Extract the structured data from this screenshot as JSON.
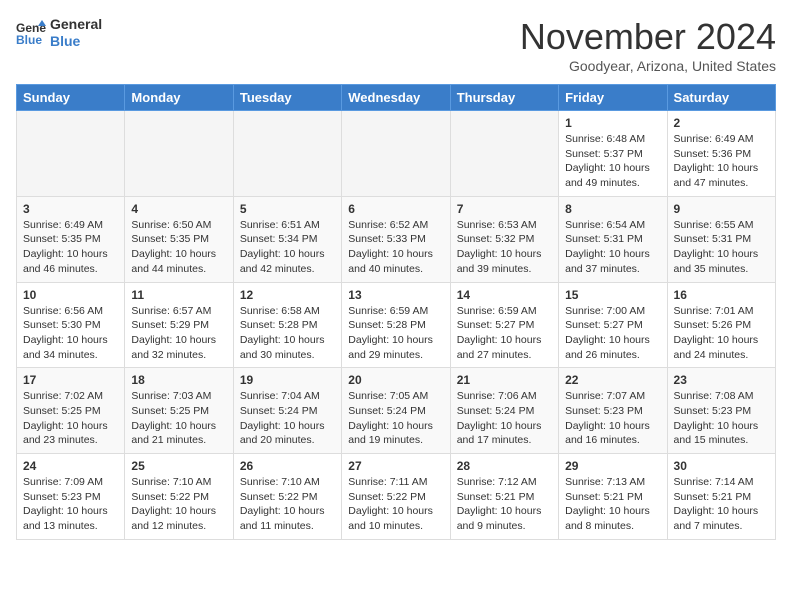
{
  "header": {
    "logo_line1": "General",
    "logo_line2": "Blue",
    "month": "November 2024",
    "location": "Goodyear, Arizona, United States"
  },
  "weekdays": [
    "Sunday",
    "Monday",
    "Tuesday",
    "Wednesday",
    "Thursday",
    "Friday",
    "Saturday"
  ],
  "weeks": [
    [
      {
        "num": "",
        "info": ""
      },
      {
        "num": "",
        "info": ""
      },
      {
        "num": "",
        "info": ""
      },
      {
        "num": "",
        "info": ""
      },
      {
        "num": "",
        "info": ""
      },
      {
        "num": "1",
        "info": "Sunrise: 6:48 AM\nSunset: 5:37 PM\nDaylight: 10 hours\nand 49 minutes."
      },
      {
        "num": "2",
        "info": "Sunrise: 6:49 AM\nSunset: 5:36 PM\nDaylight: 10 hours\nand 47 minutes."
      }
    ],
    [
      {
        "num": "3",
        "info": "Sunrise: 6:49 AM\nSunset: 5:35 PM\nDaylight: 10 hours\nand 46 minutes."
      },
      {
        "num": "4",
        "info": "Sunrise: 6:50 AM\nSunset: 5:35 PM\nDaylight: 10 hours\nand 44 minutes."
      },
      {
        "num": "5",
        "info": "Sunrise: 6:51 AM\nSunset: 5:34 PM\nDaylight: 10 hours\nand 42 minutes."
      },
      {
        "num": "6",
        "info": "Sunrise: 6:52 AM\nSunset: 5:33 PM\nDaylight: 10 hours\nand 40 minutes."
      },
      {
        "num": "7",
        "info": "Sunrise: 6:53 AM\nSunset: 5:32 PM\nDaylight: 10 hours\nand 39 minutes."
      },
      {
        "num": "8",
        "info": "Sunrise: 6:54 AM\nSunset: 5:31 PM\nDaylight: 10 hours\nand 37 minutes."
      },
      {
        "num": "9",
        "info": "Sunrise: 6:55 AM\nSunset: 5:31 PM\nDaylight: 10 hours\nand 35 minutes."
      }
    ],
    [
      {
        "num": "10",
        "info": "Sunrise: 6:56 AM\nSunset: 5:30 PM\nDaylight: 10 hours\nand 34 minutes."
      },
      {
        "num": "11",
        "info": "Sunrise: 6:57 AM\nSunset: 5:29 PM\nDaylight: 10 hours\nand 32 minutes."
      },
      {
        "num": "12",
        "info": "Sunrise: 6:58 AM\nSunset: 5:28 PM\nDaylight: 10 hours\nand 30 minutes."
      },
      {
        "num": "13",
        "info": "Sunrise: 6:59 AM\nSunset: 5:28 PM\nDaylight: 10 hours\nand 29 minutes."
      },
      {
        "num": "14",
        "info": "Sunrise: 6:59 AM\nSunset: 5:27 PM\nDaylight: 10 hours\nand 27 minutes."
      },
      {
        "num": "15",
        "info": "Sunrise: 7:00 AM\nSunset: 5:27 PM\nDaylight: 10 hours\nand 26 minutes."
      },
      {
        "num": "16",
        "info": "Sunrise: 7:01 AM\nSunset: 5:26 PM\nDaylight: 10 hours\nand 24 minutes."
      }
    ],
    [
      {
        "num": "17",
        "info": "Sunrise: 7:02 AM\nSunset: 5:25 PM\nDaylight: 10 hours\nand 23 minutes."
      },
      {
        "num": "18",
        "info": "Sunrise: 7:03 AM\nSunset: 5:25 PM\nDaylight: 10 hours\nand 21 minutes."
      },
      {
        "num": "19",
        "info": "Sunrise: 7:04 AM\nSunset: 5:24 PM\nDaylight: 10 hours\nand 20 minutes."
      },
      {
        "num": "20",
        "info": "Sunrise: 7:05 AM\nSunset: 5:24 PM\nDaylight: 10 hours\nand 19 minutes."
      },
      {
        "num": "21",
        "info": "Sunrise: 7:06 AM\nSunset: 5:24 PM\nDaylight: 10 hours\nand 17 minutes."
      },
      {
        "num": "22",
        "info": "Sunrise: 7:07 AM\nSunset: 5:23 PM\nDaylight: 10 hours\nand 16 minutes."
      },
      {
        "num": "23",
        "info": "Sunrise: 7:08 AM\nSunset: 5:23 PM\nDaylight: 10 hours\nand 15 minutes."
      }
    ],
    [
      {
        "num": "24",
        "info": "Sunrise: 7:09 AM\nSunset: 5:23 PM\nDaylight: 10 hours\nand 13 minutes."
      },
      {
        "num": "25",
        "info": "Sunrise: 7:10 AM\nSunset: 5:22 PM\nDaylight: 10 hours\nand 12 minutes."
      },
      {
        "num": "26",
        "info": "Sunrise: 7:10 AM\nSunset: 5:22 PM\nDaylight: 10 hours\nand 11 minutes."
      },
      {
        "num": "27",
        "info": "Sunrise: 7:11 AM\nSunset: 5:22 PM\nDaylight: 10 hours\nand 10 minutes."
      },
      {
        "num": "28",
        "info": "Sunrise: 7:12 AM\nSunset: 5:21 PM\nDaylight: 10 hours\nand 9 minutes."
      },
      {
        "num": "29",
        "info": "Sunrise: 7:13 AM\nSunset: 5:21 PM\nDaylight: 10 hours\nand 8 minutes."
      },
      {
        "num": "30",
        "info": "Sunrise: 7:14 AM\nSunset: 5:21 PM\nDaylight: 10 hours\nand 7 minutes."
      }
    ]
  ]
}
